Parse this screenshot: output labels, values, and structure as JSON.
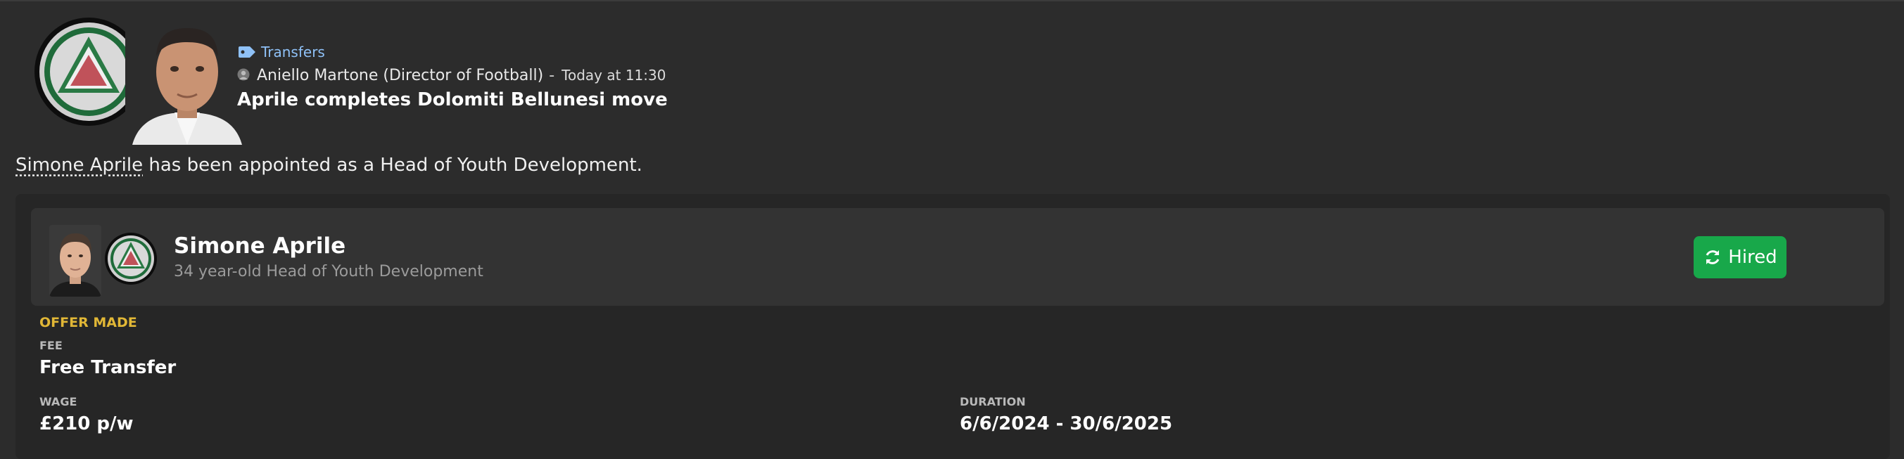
{
  "news": {
    "category": "Transfers",
    "sender": "Aniello Martone (Director of Football)",
    "separator": "-",
    "time": "Today at 11:30",
    "headline": "Aprile completes Dolomiti Bellunesi move",
    "body_link": "Simone Aprile",
    "body_rest": " has been appointed as a Head of Youth Development."
  },
  "staff": {
    "name": "Simone Aprile",
    "description": "34 year-old Head of Youth Development",
    "status_label": "Hired"
  },
  "offer": {
    "title": "OFFER MADE",
    "fee_label": "FEE",
    "fee_value": "Free Transfer",
    "wage_label": "WAGE",
    "wage_value": "£210 p/w",
    "duration_label": "DURATION",
    "duration_value": "6/6/2024 - 30/6/2025"
  },
  "icons": {
    "category": "tag-icon",
    "sender": "person-icon",
    "status": "refresh-icon"
  },
  "colors": {
    "background": "#2c2c2c",
    "card": "#333333",
    "category_link": "#8fc1f7",
    "offer_title": "#e1b736",
    "hired": "#18a84a"
  }
}
